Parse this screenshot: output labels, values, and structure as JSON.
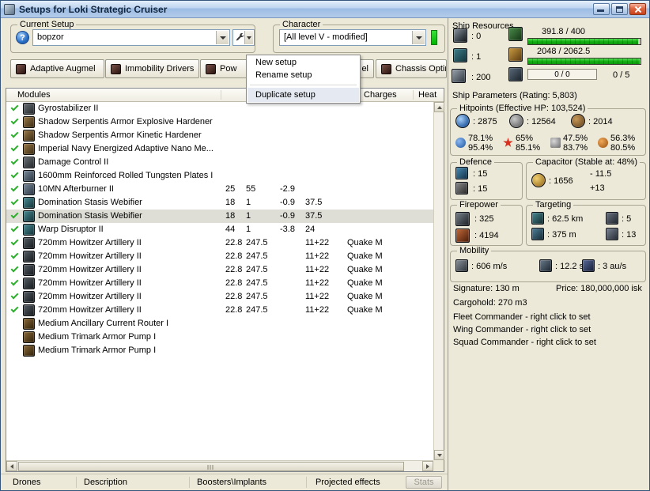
{
  "colors": {
    "bar_green": "#16ae16",
    "check_green": "#2fae2f",
    "indicator_green": "#3ae23a",
    "close_red": "#c8401c",
    "menu_highlight": "#e4e9f2"
  },
  "window": {
    "title": "Setups for Loki Strategic Cruiser"
  },
  "toolbar": {
    "current_setup_label": "Current Setup",
    "help_glyph": "?",
    "setup_value": "bopzor",
    "character_label": "Character",
    "character_value": "[All level V - modified]"
  },
  "setup_tabs": [
    {
      "label": "Adaptive Augmel"
    },
    {
      "label": "Immobility Drivers"
    },
    {
      "label": "Pow"
    },
    {
      "label": "el"
    },
    {
      "label": "Chassis Optimizal"
    }
  ],
  "context_menu": {
    "items": [
      "New setup",
      "Rename setup",
      "Duplicate setup"
    ]
  },
  "list_header": {
    "modules": "Modules",
    "charges": "Charges",
    "heat": "Heat"
  },
  "modules": [
    {
      "active": true,
      "icon": "gray",
      "name": "Gyrostabilizer II"
    },
    {
      "active": true,
      "icon": "bronze",
      "name": "Shadow Serpentis Armor Explosive Hardener"
    },
    {
      "active": true,
      "icon": "bronze",
      "name": "Shadow Serpentis Armor Kinetic Hardener"
    },
    {
      "active": true,
      "icon": "bronze",
      "name": "Imperial Navy Energized Adaptive Nano Me..."
    },
    {
      "active": true,
      "icon": "gray",
      "name": "Damage Control II"
    },
    {
      "active": true,
      "icon": "steel",
      "name": "1600mm Reinforced Rolled Tungsten Plates I"
    },
    {
      "active": true,
      "icon": "steel",
      "name": "10MN Afterburner II",
      "v1": "25",
      "v2": "55",
      "v3": "-2.9"
    },
    {
      "active": true,
      "icon": "teal",
      "name": "Domination Stasis Webifier",
      "v1": "18",
      "v2": "1",
      "v3": "-0.9",
      "v4": "37.5"
    },
    {
      "active": true,
      "icon": "teal",
      "name": "Domination Stasis Webifier",
      "v1": "18",
      "v2": "1",
      "v3": "-0.9",
      "v4": "37.5",
      "selected": true
    },
    {
      "active": true,
      "icon": "teal",
      "name": "Warp Disruptor II",
      "v1": "44",
      "v2": "1",
      "v3": "-3.8",
      "v4": "24"
    },
    {
      "active": true,
      "icon": "gun",
      "name": "720mm Howitzer Artillery II",
      "v1": "22.8",
      "v2": "247.5",
      "v4": "11+22",
      "charge": "Quake M"
    },
    {
      "active": true,
      "icon": "gun",
      "name": "720mm Howitzer Artillery II",
      "v1": "22.8",
      "v2": "247.5",
      "v4": "11+22",
      "charge": "Quake M"
    },
    {
      "active": true,
      "icon": "gun",
      "name": "720mm Howitzer Artillery II",
      "v1": "22.8",
      "v2": "247.5",
      "v4": "11+22",
      "charge": "Quake M"
    },
    {
      "active": true,
      "icon": "gun",
      "name": "720mm Howitzer Artillery II",
      "v1": "22.8",
      "v2": "247.5",
      "v4": "11+22",
      "charge": "Quake M"
    },
    {
      "active": true,
      "icon": "gun",
      "name": "720mm Howitzer Artillery II",
      "v1": "22.8",
      "v2": "247.5",
      "v4": "11+22",
      "charge": "Quake M"
    },
    {
      "active": true,
      "icon": "gun",
      "name": "720mm Howitzer Artillery II",
      "v1": "22.8",
      "v2": "247.5",
      "v4": "11+22",
      "charge": "Quake M"
    },
    {
      "active": false,
      "icon": "rig",
      "name": "Medium Ancillary Current Router I"
    },
    {
      "active": false,
      "icon": "rig",
      "name": "Medium Trimark Armor Pump I"
    },
    {
      "active": false,
      "icon": "rig",
      "name": "Medium Trimark Armor Pump I"
    }
  ],
  "bottom_bar": {
    "tabs": [
      "Drones",
      "Description",
      "Boosters\\Implants",
      "Projected effects"
    ],
    "stats_button": "Stats"
  },
  "ship_resources": {
    "label": "Ship Resources",
    "turrets_value": ": 0",
    "launchers_value": ": 1",
    "calibration_value": ": 200",
    "cpu_text": "391.8 / 400",
    "cpu_pct": 98,
    "powergrid_text": "2048 / 2062.5",
    "powergrid_pct": 99,
    "dronebay_text": "0 / 0",
    "drone_bandwidth_text": "0 / 5"
  },
  "ship_parameters": {
    "title": "Ship Parameters (Rating: 5,803)",
    "hitpoints": {
      "label": "Hitpoints (Effective HP: 103,524)",
      "shield": ": 2875",
      "armor": ": 12564",
      "hull": ": 2014",
      "resists": [
        {
          "top": "78.1%",
          "bottom": "95.4%"
        },
        {
          "top": "65%",
          "bottom": "85.1%"
        },
        {
          "top": "47.5%",
          "bottom": "83.7%"
        },
        {
          "top": "56.3%",
          "bottom": "80.5%"
        }
      ]
    },
    "defence": {
      "label": "Defence",
      "value1": ": 15",
      "value2": ": 15"
    },
    "capacitor": {
      "label": "Capacitor (Stable at: 48%)",
      "amount": ": 1656",
      "drain": "- 11.5",
      "recharge": "+13"
    },
    "firepower": {
      "label": "Firepower",
      "volley": ": 325",
      "dps": ": 4194"
    },
    "targeting": {
      "label": "Targeting",
      "range": ": 62.5 km",
      "max_targets": ": 5",
      "scan_resolution": ": 375 m",
      "sensor_strength": ": 13"
    },
    "mobility": {
      "label": "Mobility",
      "speed": ": 606 m/s",
      "align_time": ": 12.2 s",
      "warp_speed": ": 3 au/s"
    },
    "info": {
      "signature": "Signature: 130 m",
      "price": "Price: 180,000,000 isk",
      "cargohold": "Cargohold: 270 m3",
      "fleet_commander": "Fleet Commander - right click to set",
      "wing_commander": "Wing Commander - right click to set",
      "squad_commander": "Squad Commander - right click to set"
    }
  }
}
